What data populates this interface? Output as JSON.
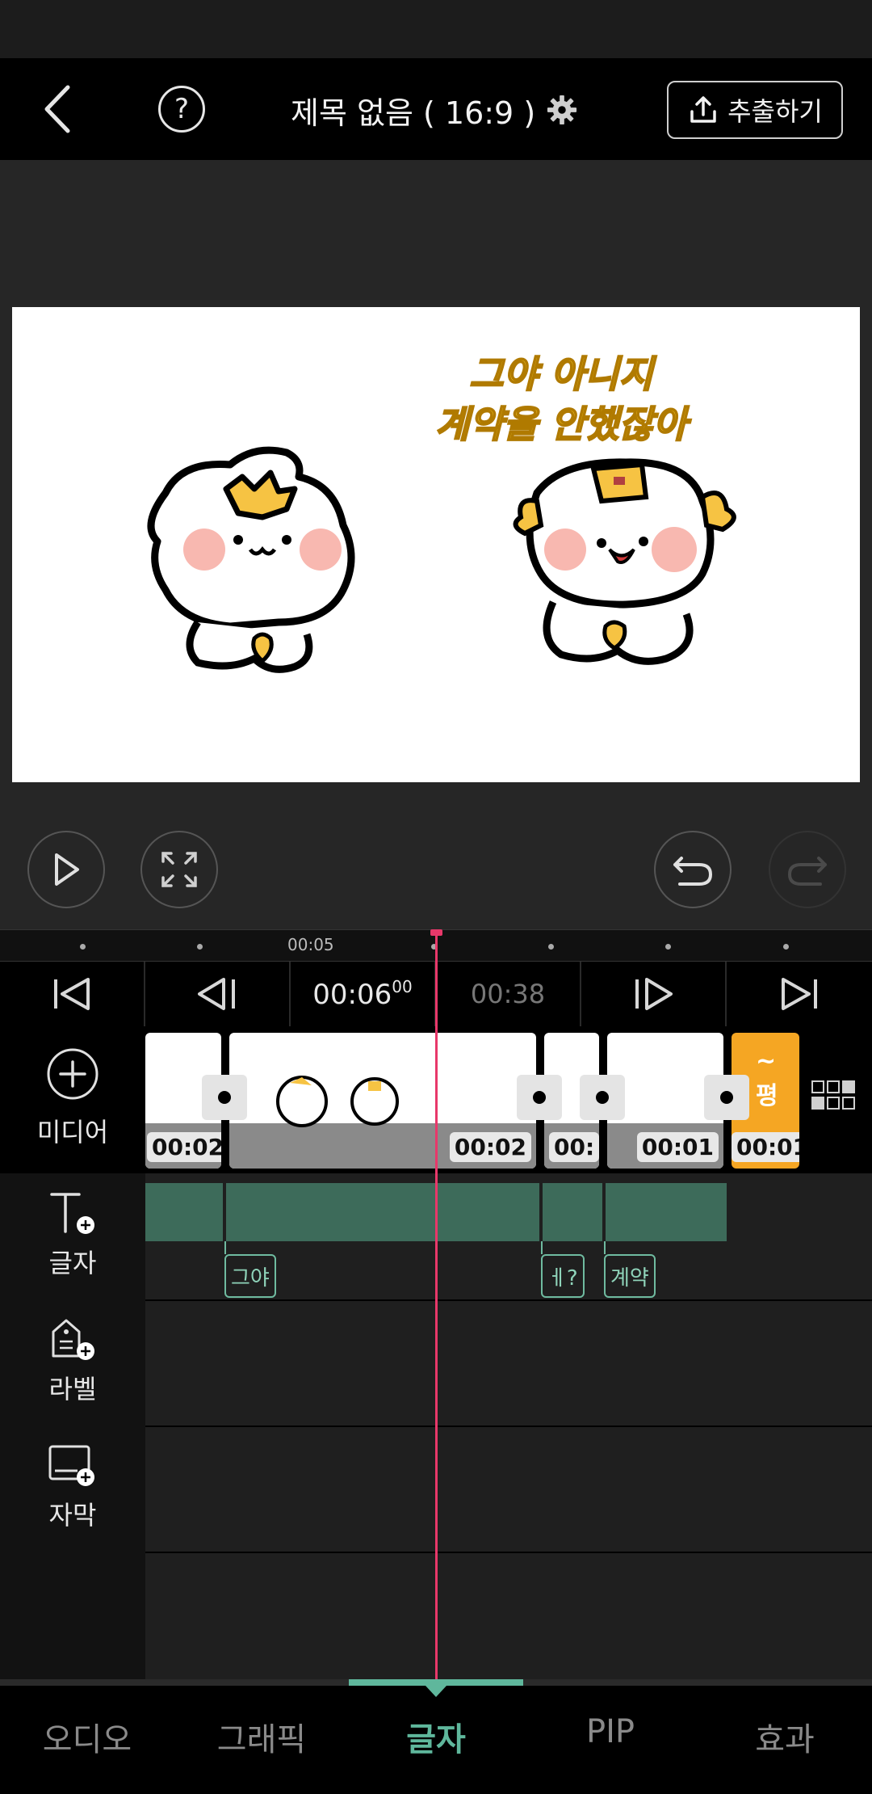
{
  "header": {
    "title": "제목 없음 ( 16:9 )",
    "help_glyph": "?",
    "export_label": "추출하기"
  },
  "preview": {
    "caption_line1": "그야 아니지",
    "caption_line2": "계약을 안했잖아"
  },
  "ruler": {
    "label": "00:05"
  },
  "navbar": {
    "current_time": "00:06",
    "current_frames": "00",
    "total_time": "00:38"
  },
  "media": {
    "label": "미디어",
    "clips": [
      "00:02",
      "00:02",
      "00:",
      "00:01",
      "00:01"
    ],
    "last_clip_text": "~ 평"
  },
  "side": {
    "text_label": "글자",
    "label_label": "라벨",
    "subtitle_label": "자막"
  },
  "text_tags": [
    "그야",
    "ㅔ?",
    "계약"
  ],
  "tabs": [
    "오디오",
    "그래픽",
    "글자",
    "PIP",
    "효과"
  ],
  "colors": {
    "accent": "#5fb79c",
    "playhead": "#e8386a",
    "text_clip": "#3d6b5a"
  }
}
